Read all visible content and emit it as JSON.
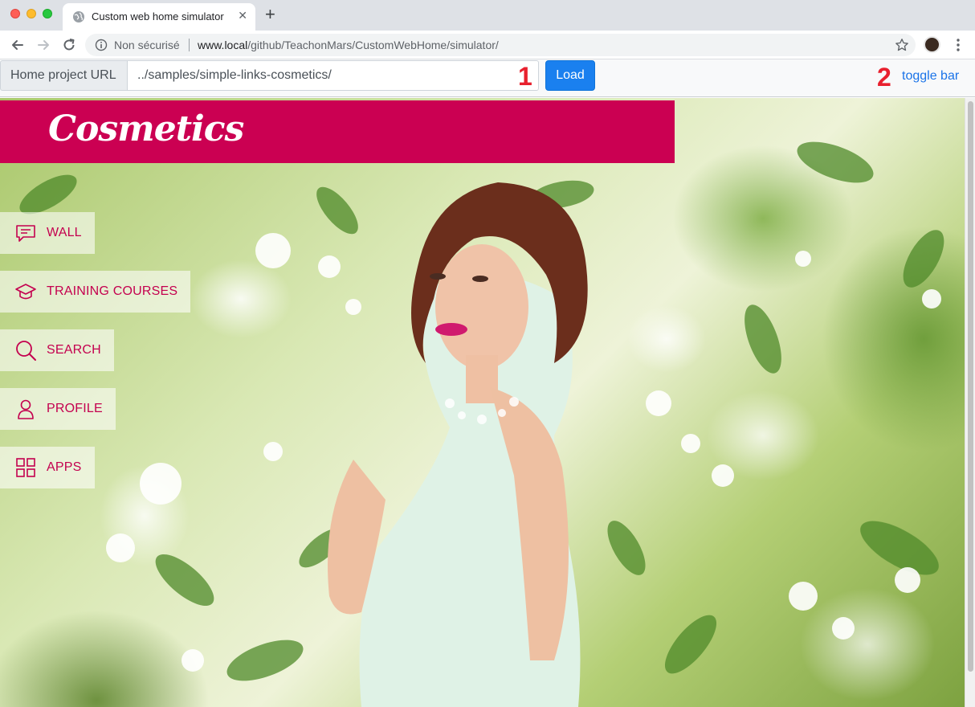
{
  "browser": {
    "tab_title": "Custom web home simulator",
    "security_label": "Non sécurisé",
    "url_host": "www.local",
    "url_path": "/github/TeachonMars/CustomWebHome/simulator/"
  },
  "simulator": {
    "url_label": "Home project URL",
    "url_value": "../samples/simple-links-cosmetics/",
    "marker_1": "1",
    "load_label": "Load",
    "marker_2": "2",
    "toggle_label": "toggle bar"
  },
  "page": {
    "brand_title": "Cosmetics",
    "brand_color": "#cb0052",
    "nav": [
      {
        "label": "WALL",
        "icon": "chat-icon"
      },
      {
        "label": "TRAINING COURSES",
        "icon": "graduation-cap-icon"
      },
      {
        "label": "SEARCH",
        "icon": "search-icon"
      },
      {
        "label": "PROFILE",
        "icon": "user-icon"
      },
      {
        "label": "APPS",
        "icon": "apps-grid-icon"
      }
    ]
  }
}
